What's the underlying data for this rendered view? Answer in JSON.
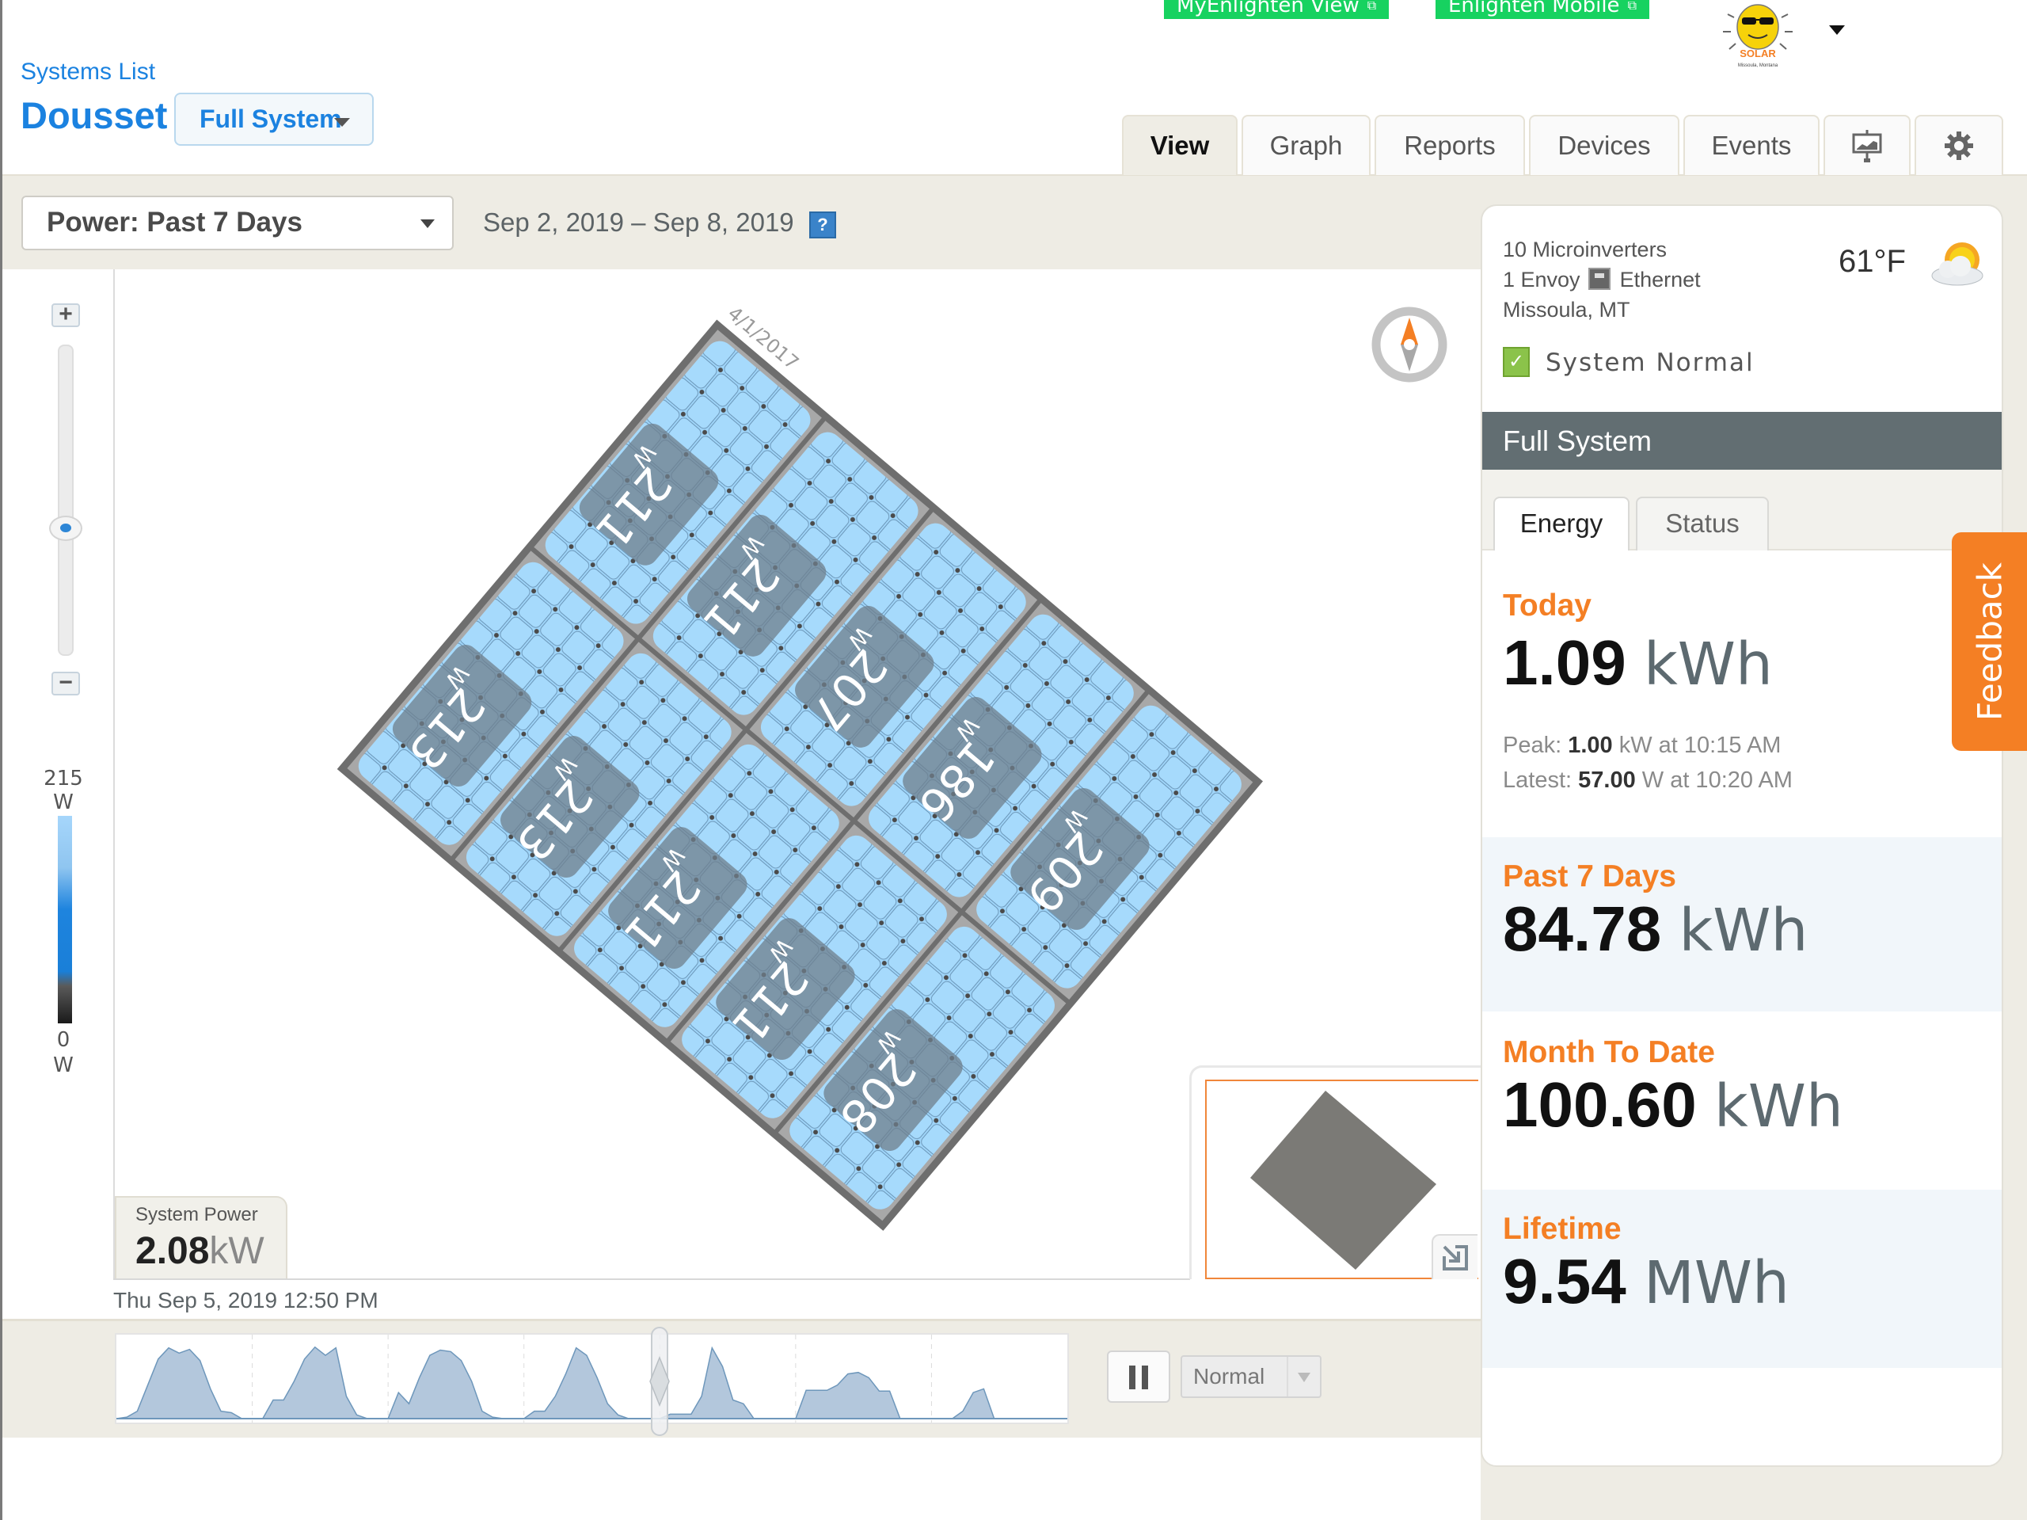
{
  "header": {
    "links": [
      {
        "label": "MyEnlighten View"
      },
      {
        "label": "Enlighten Mobile"
      }
    ],
    "breadcrumb": "Systems List",
    "system_name": "Dousset",
    "system_scope": "Full System",
    "logo_text": "SOLAR",
    "logo_subtext": "Missoula, Montana"
  },
  "tabs": [
    {
      "label": "View",
      "active": true
    },
    {
      "label": "Graph"
    },
    {
      "label": "Reports"
    },
    {
      "label": "Devices"
    },
    {
      "label": "Events"
    },
    {
      "icon": "presentation-icon"
    },
    {
      "icon": "gear-icon"
    }
  ],
  "toolbar": {
    "power_select": "Power: Past 7 Days",
    "date_range": "Sep 2, 2019 – Sep 8, 2019",
    "help_label": "?"
  },
  "map": {
    "zoom_in": "+",
    "zoom_out": "−",
    "zoom_level": 0.6,
    "legend_max_value": "215",
    "legend_max_unit": "W",
    "legend_min_value": "0",
    "legend_min_unit": "W",
    "install_date": "4/1/2017",
    "panels": [
      {
        "row": 0,
        "col": 0,
        "watts": "211",
        "unit": "W"
      },
      {
        "row": 0,
        "col": 1,
        "watts": "211",
        "unit": "W"
      },
      {
        "row": 0,
        "col": 2,
        "watts": "207",
        "unit": "W"
      },
      {
        "row": 0,
        "col": 3,
        "watts": "186",
        "unit": "W"
      },
      {
        "row": 0,
        "col": 4,
        "watts": "209",
        "unit": "W"
      },
      {
        "row": 1,
        "col": 0,
        "watts": "213",
        "unit": "W"
      },
      {
        "row": 1,
        "col": 1,
        "watts": "213",
        "unit": "W"
      },
      {
        "row": 1,
        "col": 2,
        "watts": "211",
        "unit": "W"
      },
      {
        "row": 1,
        "col": 3,
        "watts": "211",
        "unit": "W"
      },
      {
        "row": 1,
        "col": 4,
        "watts": "208",
        "unit": "W"
      }
    ],
    "system_power_label": "System Power",
    "system_power_value": "2.08",
    "system_power_unit": "kW",
    "timestamp": "Thu Sep 5, 2019 12:50 PM"
  },
  "timeline": {
    "days": 7,
    "playhead_fraction": 0.5,
    "speed": "Normal"
  },
  "panel": {
    "microinverters": "10 Microinverters",
    "envoy": "1 Envoy",
    "connection": "Ethernet",
    "location": "Missoula, MT",
    "temperature": "61°F",
    "status": "System Normal",
    "scope_title": "Full System",
    "sub_tabs": [
      {
        "label": "Energy",
        "active": true
      },
      {
        "label": "Status"
      }
    ],
    "today": {
      "title": "Today",
      "value": "1.09",
      "unit": "kWh",
      "peak_label": "Peak:",
      "peak_value": "1.00",
      "peak_rest": "kW at 10:15 AM",
      "latest_label": "Latest:",
      "latest_value": "57.00",
      "latest_rest": "W at 10:20 AM"
    },
    "past7": {
      "title": "Past 7 Days",
      "value": "84.78",
      "unit": "kWh"
    },
    "mtd": {
      "title": "Month To Date",
      "value": "100.60",
      "unit": "kWh"
    },
    "lifetime": {
      "title": "Lifetime",
      "value": "9.54",
      "unit": "MWh"
    }
  },
  "feedback_label": "Feedback",
  "colors": {
    "brand_blue": "#1b82e0",
    "accent_orange": "#f47f24",
    "link_green": "#17d260",
    "panel_blue": "#a3d8fb",
    "scope_bar": "#626e72"
  }
}
